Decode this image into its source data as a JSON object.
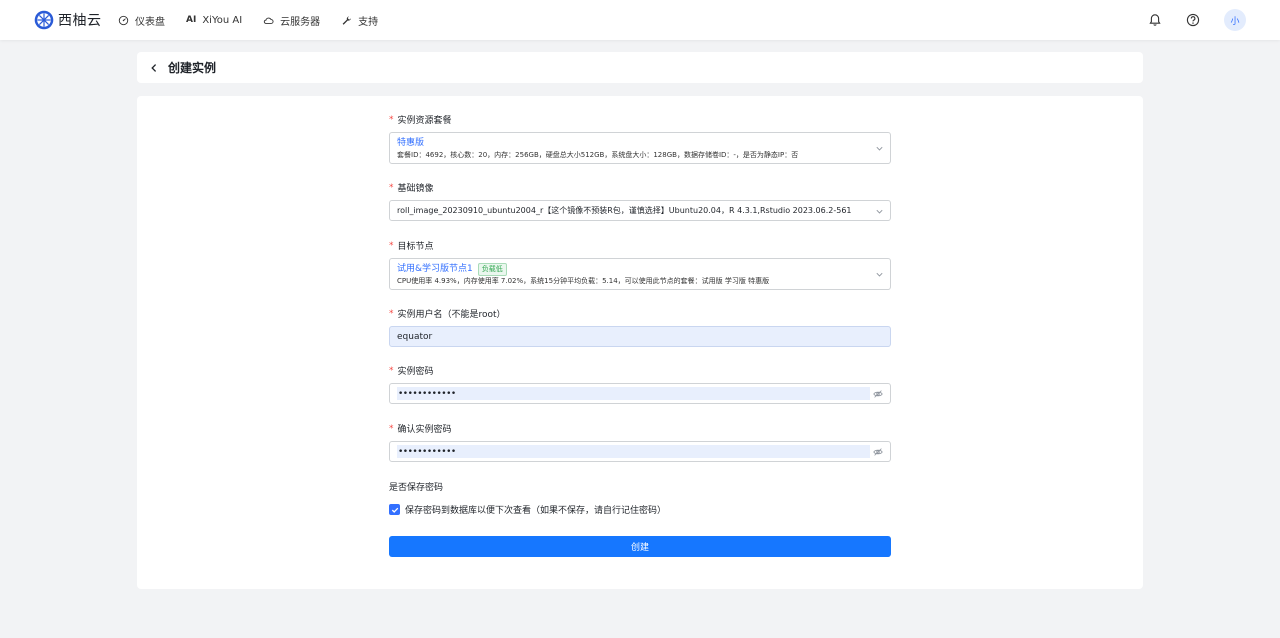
{
  "brand": {
    "name": "西柚云",
    "logo_icon": "citrus-logo-icon"
  },
  "nav": {
    "items": [
      {
        "label": "仪表盘",
        "icon": "dashboard-icon"
      },
      {
        "label": "XiYou AI",
        "icon": "ai-icon",
        "icon_text": "AI"
      },
      {
        "label": "云服务器",
        "icon": "cloud-icon"
      },
      {
        "label": "支持",
        "icon": "wrench-icon"
      }
    ]
  },
  "topbar_right": {
    "bell_icon": "bell-icon",
    "help_icon": "help-icon",
    "avatar_text": "小"
  },
  "header": {
    "title": "创建实例",
    "back_icon": "chevron-left-icon"
  },
  "form": {
    "required_mark": "*",
    "package": {
      "label": "实例资源套餐",
      "title": "特惠版",
      "detail": "套餐ID：4692，核心数：20，内存：256GB，硬盘总大小512GB，系统盘大小：128GB，数据存储卷ID：-，是否为静态IP：否"
    },
    "image": {
      "label": "基础镜像",
      "value": "roll_image_20230910_ubuntu2004_r【这个镜像不预装R包，谨慎选择】Ubuntu20.04，R 4.3.1,Rstudio 2023.06.2-561"
    },
    "node": {
      "label": "目标节点",
      "title": "试用&学习版节点1",
      "tag": "负载低",
      "detail": "CPU使用率 4.93%，内存使用率 7.02%，系统15分钟平均负载：5.14，可以使用此节点的套餐：试用版 学习版 特惠版"
    },
    "username": {
      "label": "实例用户名（不能是root）",
      "value": "equator"
    },
    "password": {
      "label": "实例密码",
      "masked": "••••••••••••"
    },
    "confirm_password": {
      "label": "确认实例密码",
      "masked": "••••••••••••"
    },
    "save_password": {
      "label": "是否保存密码",
      "checked": true,
      "option": "保存密码到数据库以便下次查看（如果不保存，请自行记住密码）"
    },
    "submit_label": "创建"
  },
  "colors": {
    "accent": "#3370ff",
    "button": "#1677ff",
    "required": "#f54a45",
    "tag_green": "#34a853"
  }
}
